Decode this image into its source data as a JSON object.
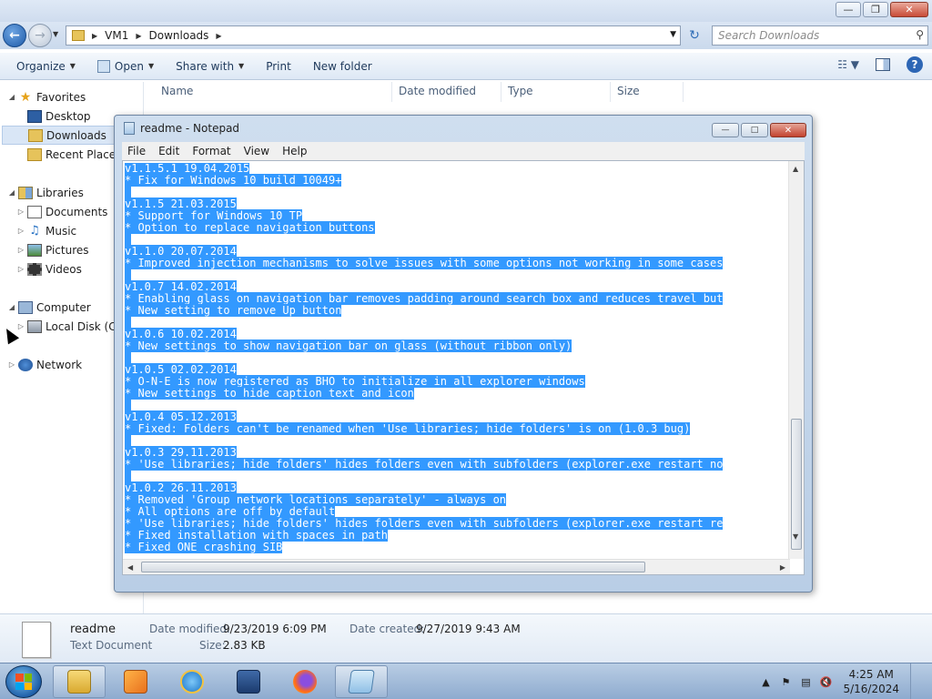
{
  "explorer": {
    "breadcrumb": [
      "VM1",
      "Downloads"
    ],
    "search_placeholder": "Search Downloads",
    "toolbar": {
      "organize": "Organize",
      "open": "Open",
      "share_with": "Share with",
      "print": "Print",
      "new_folder": "New folder"
    },
    "columns": [
      "Name",
      "Date modified",
      "Type",
      "Size"
    ],
    "nav": {
      "favorites": "Favorites",
      "desktop": "Desktop",
      "downloads": "Downloads",
      "recent_places": "Recent Places",
      "libraries": "Libraries",
      "documents": "Documents",
      "music": "Music",
      "pictures": "Pictures",
      "videos": "Videos",
      "computer": "Computer",
      "local_disk": "Local Disk (C:)",
      "network": "Network"
    },
    "details": {
      "file_name": "readme",
      "file_type": "Text Document",
      "date_modified_label": "Date modified:",
      "date_modified": "9/23/2019 6:09 PM",
      "date_created_label": "Date created:",
      "date_created": "9/27/2019 9:43 AM",
      "size_label": "Size:",
      "size": "2.83 KB"
    }
  },
  "notepad": {
    "title": "readme - Notepad",
    "menu": [
      "File",
      "Edit",
      "Format",
      "View",
      "Help"
    ],
    "lines": [
      "v1.1.5.1 19.04.2015",
      "* Fix for Windows 10 build 10049+",
      "",
      "v1.1.5 21.03.2015",
      "* Support for Windows 10 TP",
      "* Option to replace navigation buttons",
      "",
      "v1.1.0 20.07.2014",
      "* Improved injection mechanisms to solve issues with some options not working in some cases",
      "",
      "v1.0.7 14.02.2014",
      "* Enabling glass on navigation bar removes padding around search box and reduces travel but",
      "* New setting to remove Up button",
      "",
      "v1.0.6 10.02.2014",
      "* New settings to show navigation bar on glass (without ribbon only)",
      "",
      "v1.0.5 02.02.2014",
      "* O-N-E is now registered as BHO to initialize in all explorer windows",
      "* New settings to hide caption text and icon",
      "",
      "v1.0.4 05.12.2013",
      "* Fixed: Folders can't be renamed when 'Use libraries; hide folders' is on (1.0.3 bug)",
      "",
      "v1.0.3 29.11.2013",
      "* 'Use libraries; hide folders' hides folders even with subfolders (explorer.exe restart no",
      "",
      "v1.0.2 26.11.2013",
      "* Removed 'Group network locations separately' - always on",
      "* All options are off by default",
      "* 'Use libraries; hide folders' hides folders even with subfolders (explorer.exe restart re",
      "* Fixed installation with spaces in path",
      "* Fixed ONE crashing SIB"
    ]
  },
  "taskbar": {
    "time": "4:25 AM",
    "date": "5/16/2024"
  },
  "colors": {
    "selection": "#3399ff",
    "taskbar": "#8eabcf"
  }
}
